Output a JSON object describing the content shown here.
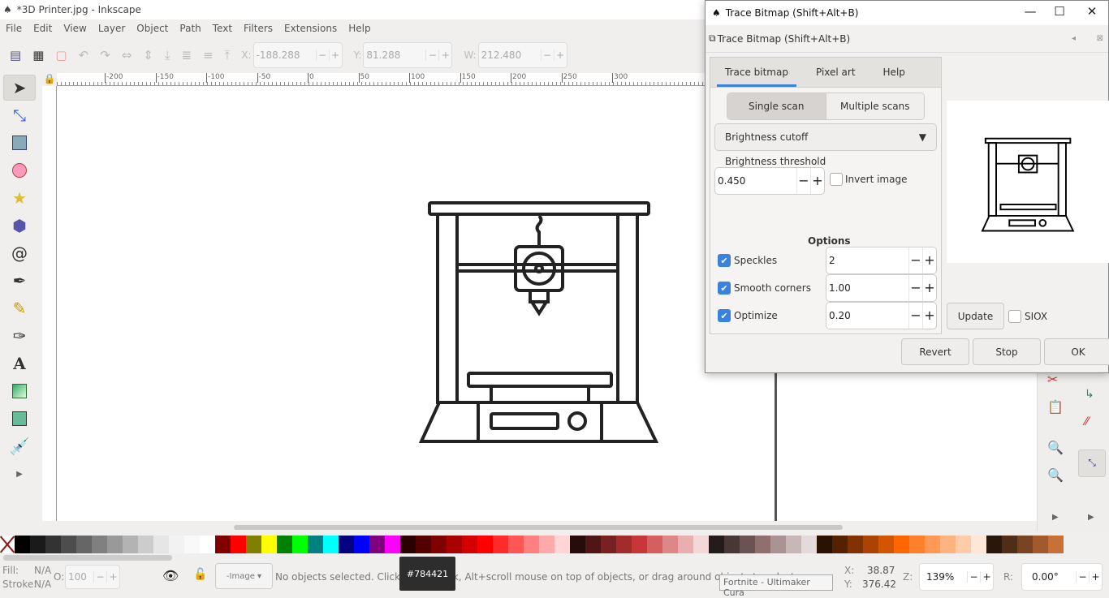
{
  "window": {
    "title": "*3D Printer.jpg - Inkscape"
  },
  "menu": [
    "File",
    "Edit",
    "View",
    "Layer",
    "Object",
    "Path",
    "Text",
    "Filters",
    "Extensions",
    "Help"
  ],
  "toolbar": {
    "x_label": "X:",
    "x_value": "-188.288",
    "y_label": "Y:",
    "y_value": "81.288",
    "w_label": "W:",
    "w_value": "212.480"
  },
  "ruler": {
    "ticks": [
      "-200",
      "-150",
      "-100",
      "-50",
      "0",
      "50",
      "100",
      "150",
      "200",
      "250",
      "300"
    ]
  },
  "tools": [
    "selector-tool",
    "node-tool",
    "rectangle-tool",
    "ellipse-tool",
    "star-tool",
    "3d-box-tool",
    "spiral-tool",
    "pen-tool",
    "pencil-tool",
    "calligraphy-tool",
    "text-tool",
    "gradient-tool",
    "mesh-tool",
    "dropper-tool"
  ],
  "palette": [
    "#000000",
    "#1a1a1a",
    "#333333",
    "#4d4d4d",
    "#666666",
    "#808080",
    "#999999",
    "#b3b3b3",
    "#cccccc",
    "#e6e6e6",
    "#f2f2f2",
    "#f9f9f9",
    "#ffffff",
    "#800000",
    "#ff0000",
    "#808000",
    "#ffff00",
    "#008000",
    "#00ff00",
    "#008080",
    "#00ffff",
    "#000080",
    "#0000ff",
    "#800080",
    "#ff00ff",
    "#2b0000",
    "#550000",
    "#800000",
    "#aa0000",
    "#d40000",
    "#ff0000",
    "#ff2a2a",
    "#ff5555",
    "#ff8080",
    "#ffaaaa",
    "#ffd5d5",
    "#280b0b",
    "#501616",
    "#782121",
    "#a02c2c",
    "#c83737",
    "#d35f5f",
    "#de8787",
    "#e9afaf",
    "#f4d7d7",
    "#241c1c",
    "#483737",
    "#6c5353",
    "#916f6f",
    "#ac9393",
    "#c8b7b7",
    "#e3dbdb",
    "#2b1100",
    "#552200",
    "#803300",
    "#aa4400",
    "#d45500",
    "#ff6600",
    "#ff7f2a",
    "#ff9955",
    "#ffb380",
    "#ffccaa",
    "#ffe6d5",
    "#28170b",
    "#502d16",
    "#784421",
    "#a05a2c",
    "#c87137"
  ],
  "status": {
    "fill_label": "Fill:",
    "fill_value": "N/A",
    "stroke_label": "Stroke:",
    "stroke_value": "N/A",
    "opacity_label": "O:",
    "opacity_value": "100",
    "layer": "-Image",
    "message": "No objects selected. Click, Shift+click, Alt+scroll mouse on top of objects, or drag around objects to select.",
    "x_label": "X:",
    "x_value": "38.87",
    "y_label": "Y:",
    "y_value": "376.42",
    "zoom_label": "Z:",
    "zoom_value": "139%",
    "rotate_label": "R:",
    "rotate_value": "0.00°"
  },
  "tooltips": {
    "color": "#784421",
    "taskbar": "Fortnite - Ultimaker Cura"
  },
  "dialog": {
    "window_title": "Trace Bitmap (Shift+Alt+B)",
    "panel_title": "Trace Bitmap (Shift+Alt+B)",
    "tabs": [
      {
        "label": "Trace bitmap",
        "active": true
      },
      {
        "label": "Pixel art"
      },
      {
        "label": "Help"
      }
    ],
    "scan_modes": [
      {
        "label": "Single scan",
        "active": true
      },
      {
        "label": "Multiple scans"
      }
    ],
    "mode": "Brightness cutoff",
    "threshold_label": "Brightness threshold",
    "threshold_value": "0.450",
    "invert_label": "Invert image",
    "invert_checked": false,
    "options_heading": "Options",
    "options": [
      {
        "label": "Speckles",
        "checked": true,
        "value": "2"
      },
      {
        "label": "Smooth corners",
        "checked": true,
        "value": "1.00"
      },
      {
        "label": "Optimize",
        "checked": true,
        "value": "0.20"
      }
    ],
    "update_label": "Update",
    "siox_label": "SIOX",
    "siox_checked": false,
    "buttons": {
      "revert": "Revert",
      "stop": "Stop",
      "ok": "OK"
    }
  }
}
